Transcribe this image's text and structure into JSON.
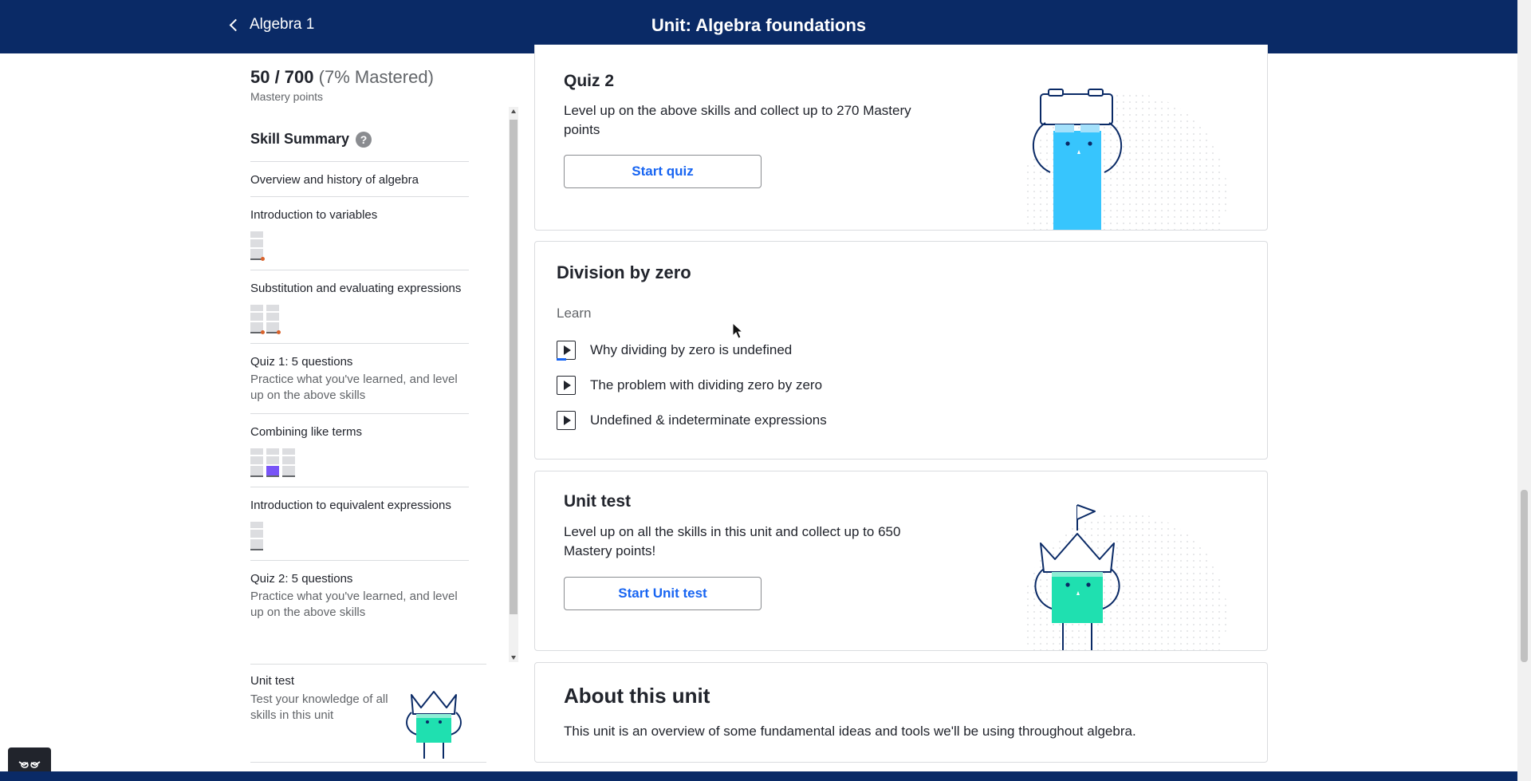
{
  "header": {
    "back_label": "Algebra 1",
    "title": "Unit: Algebra foundations"
  },
  "mastery": {
    "points": "50 / 700",
    "percent": "(7% Mastered)",
    "label": "Mastery points"
  },
  "skill_summary": {
    "heading": "Skill Summary",
    "help": "?",
    "items": [
      {
        "title": "Overview and history of algebra"
      },
      {
        "title": "Introduction to variables"
      },
      {
        "title": "Substitution and evaluating expressions"
      },
      {
        "title": "Quiz 1: 5 questions",
        "desc": "Practice what you've learned, and level up on the above skills"
      },
      {
        "title": "Combining like terms"
      },
      {
        "title": "Introduction to equivalent expressions"
      },
      {
        "title": "Quiz 2: 5 questions",
        "desc": "Practice what you've learned, and level up on the above skills"
      }
    ],
    "unit_test": {
      "title": "Unit test",
      "desc": "Test your knowledge of all skills in this unit"
    }
  },
  "quiz2": {
    "title": "Quiz 2",
    "desc": "Level up on the above skills and collect up to 270 Mastery points",
    "button": "Start quiz"
  },
  "division_by_zero": {
    "title": "Division by zero",
    "learn_label": "Learn",
    "videos": [
      {
        "title": "Why dividing by zero is undefined"
      },
      {
        "title": "The problem with dividing zero by zero"
      },
      {
        "title": "Undefined & indeterminate expressions"
      }
    ]
  },
  "unit_test": {
    "title": "Unit test",
    "desc": "Level up on all the skills in this unit and collect up to 650 Mastery points!",
    "button": "Start Unit test"
  },
  "about": {
    "title": "About this unit",
    "desc": "This unit is an overview of some fundamental ideas and tools we'll be using throughout algebra."
  },
  "colors": {
    "nav": "#0a2a66",
    "link": "#1865f2",
    "quiz_character": "#37c5fd",
    "unit_character": "#1fe0b0",
    "mastered_block": "#7854f7"
  },
  "icons": {
    "back": "chevron-left-icon",
    "help": "question-circle-icon",
    "video": "play-icon",
    "accessibility": "glasses-icon"
  }
}
